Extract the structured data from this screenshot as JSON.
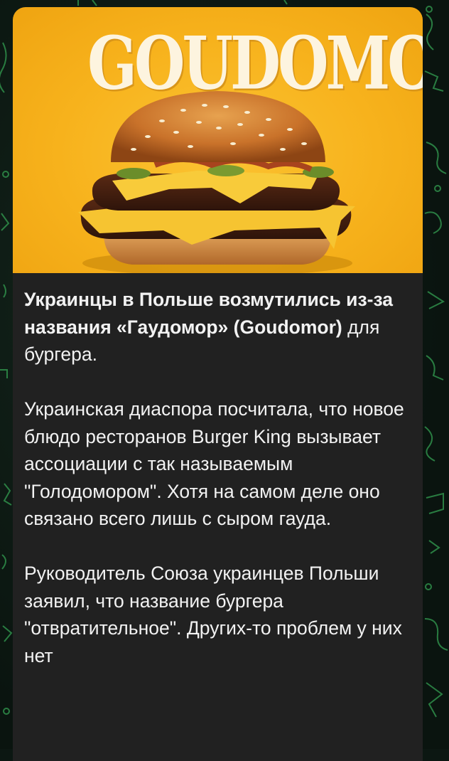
{
  "post": {
    "image_title": "GOUDOMOR",
    "headline_bold": "Украинцы в Польше возмутились из-за названия «Гаудомор» (Goudomor)",
    "headline_rest": " для бургера.",
    "paragraph_2": "Украинская диаспора посчитала, что новое блюдо ресторанов Burger King вызывает ассоциации с так называемым \"Голодомором\". Хотя на самом деле оно связано всего лишь с сыром гауда.",
    "paragraph_3": "Руководитель Союза украинцев Польши заявил, что название бургера \"отвратительное\". Других-то проблем у них нет"
  },
  "colors": {
    "bubble_bg": "#212121",
    "text": "#f2f2f2",
    "photo_bg": "#f7b21c",
    "wallpaper": "#0c1712",
    "doodle": "#2f8f4a"
  }
}
